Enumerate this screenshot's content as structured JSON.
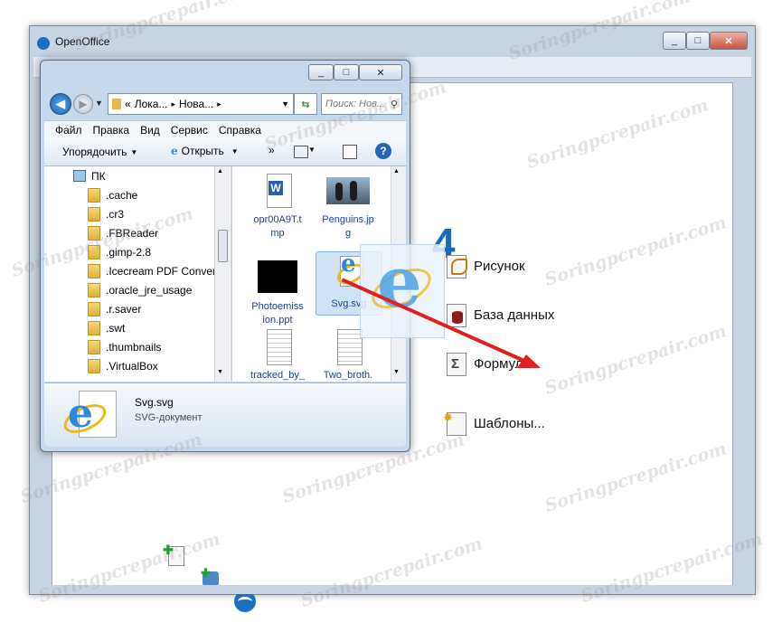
{
  "main_window": {
    "title": "OpenOffice",
    "version_fragment": "4",
    "start_center": {
      "items": [
        {
          "label": "Рисунок",
          "icon": "drawing-icon"
        },
        {
          "label": "База данных",
          "icon": "database-icon"
        },
        {
          "label": "Формула",
          "icon": "formula-icon"
        },
        {
          "label": "Шаблоны...",
          "icon": "templates-icon"
        }
      ],
      "bottom_icons": [
        "new-document-icon",
        "extensions-icon",
        "openoffice-logo-icon"
      ]
    }
  },
  "explorer": {
    "address_segments": [
      "«",
      "Лока...",
      "▸",
      "Нова...",
      "▸"
    ],
    "search_placeholder": "Поиск: Нов...",
    "menu": [
      "Файл",
      "Правка",
      "Вид",
      "Сервис",
      "Справка"
    ],
    "toolbar": {
      "organize": "Упорядочить",
      "open": "Открыть",
      "more": "»"
    },
    "tree": [
      {
        "label": "ПК",
        "icon": "computer-icon"
      },
      {
        "label": ".cache"
      },
      {
        "label": ".cr3"
      },
      {
        "label": ".FBReader"
      },
      {
        "label": ".gimp-2.8"
      },
      {
        "label": ".Icecream PDF Converte"
      },
      {
        "label": ".oracle_jre_usage"
      },
      {
        "label": ".r.saver"
      },
      {
        "label": ".swt"
      },
      {
        "label": ".thumbnails"
      },
      {
        "label": ".VirtualBox"
      }
    ],
    "files": [
      {
        "name": "opr00A9T.tmp",
        "line1": "opr00A9T.t",
        "line2": "mp",
        "icon": "word-document-icon"
      },
      {
        "name": "Penguins.jpg",
        "line1": "Penguins.jp",
        "line2": "g",
        "icon": "image-thumbnail-icon"
      },
      {
        "name": "Photoemission.ppt",
        "line1": "Photoemiss",
        "line2": "ion.ppt",
        "icon": "presentation-icon"
      },
      {
        "name": "Svg.svg",
        "line1": "Svg.svg",
        "line2": "",
        "icon": "ie-document-icon"
      },
      {
        "name": "tracked_by_",
        "line1": "tracked_by_",
        "line2": "",
        "icon": "text-file-icon"
      },
      {
        "name": "Two_broth...",
        "line1": "Two_broth.",
        "line2": "",
        "icon": "text-file-icon"
      }
    ],
    "details": {
      "name": "Svg.svg",
      "type": "SVG-документ"
    }
  },
  "watermark": "Soringpcrepair.com",
  "colors": {
    "accent": "#1b69b8",
    "drag_arrow": "#e02020",
    "titlebar": "#c8d4e2"
  }
}
